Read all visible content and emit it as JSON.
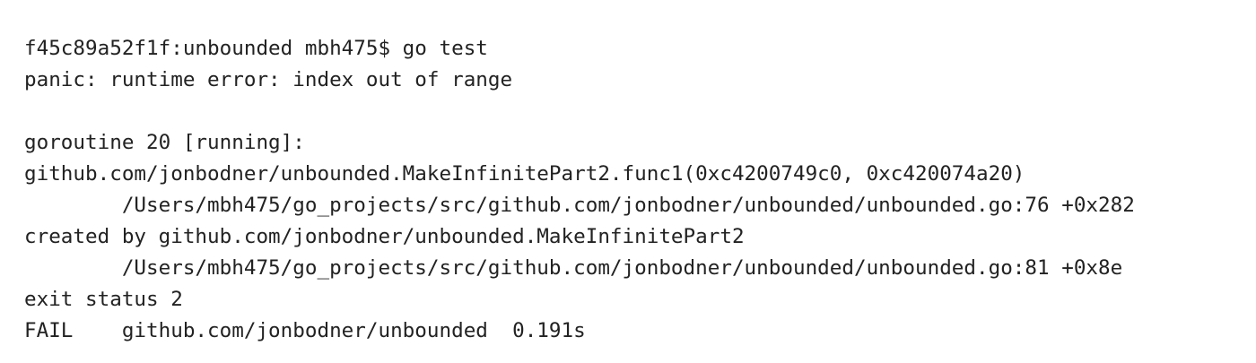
{
  "terminal": {
    "lines": [
      "f45c89a52f1f:unbounded mbh475$ go test",
      "panic: runtime error: index out of range",
      "",
      "goroutine 20 [running]:",
      "github.com/jonbodner/unbounded.MakeInfinitePart2.func1(0xc4200749c0, 0xc420074a20)",
      "        /Users/mbh475/go_projects/src/github.com/jonbodner/unbounded/unbounded.go:76 +0x282",
      "created by github.com/jonbodner/unbounded.MakeInfinitePart2",
      "        /Users/mbh475/go_projects/src/github.com/jonbodner/unbounded/unbounded.go:81 +0x8e",
      "exit status 2",
      "FAIL    github.com/jonbodner/unbounded  0.191s"
    ]
  }
}
